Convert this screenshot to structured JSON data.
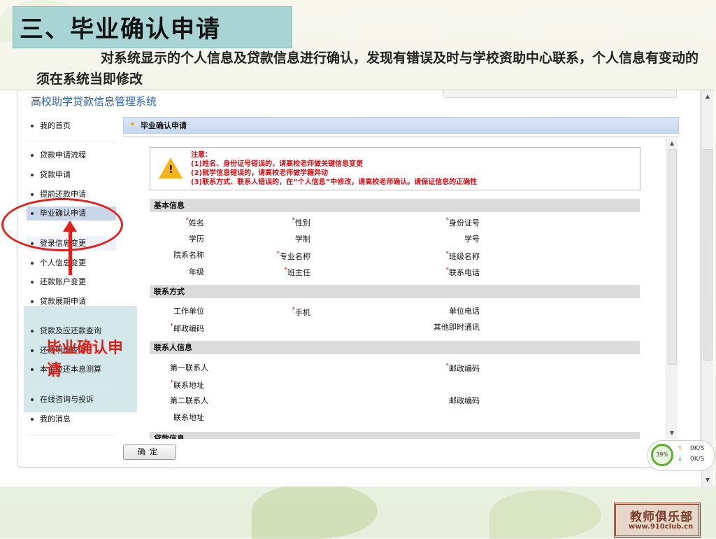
{
  "slide": {
    "title": "三、毕业确认申请",
    "description": "对系统显示的个人信息及贷款信息进行确认，发现有错误及时与学校资助中心联系，个人信息有变动的须在系统当即修改",
    "annotation": "毕业确认申请"
  },
  "system": {
    "title": "高校助学贷款信息管理系统"
  },
  "nav": {
    "items": [
      {
        "label": "我的首页"
      },
      {
        "label": "贷款申请流程"
      },
      {
        "label": "贷款申请"
      },
      {
        "label": "提前还款申请"
      },
      {
        "label": "毕业确认申请"
      },
      {
        "label": "登录信息变更"
      },
      {
        "label": "个人信息变更"
      },
      {
        "label": "还款账户变更"
      },
      {
        "label": "贷款展期申请"
      },
      {
        "label": "贷款及应还款查询"
      },
      {
        "label": "还款明细查询"
      },
      {
        "label": "本金应还本息测算"
      },
      {
        "label": "在线咨询与投诉"
      },
      {
        "label": "我的消息"
      }
    ]
  },
  "content": {
    "header": "毕业确认申请",
    "notice": {
      "title": "注意：",
      "line1": "(1)姓名、身份证号错误的，请高校老师做关键信息变更",
      "line2": "(2)就学信息错误的，请高校老师做学籍异动",
      "line3": "(3)联系方式、联系人错误的，在“个人信息”中修改，请高校老师确认。请保证信息的正确性"
    },
    "sections": {
      "basic": "基本信息",
      "contact": "联系方式",
      "contact_person": "联系人信息",
      "loan": "贷款信息"
    },
    "fields": {
      "name": "姓名",
      "gender": "性别",
      "id_number": "身份证号",
      "education": "学历",
      "school_system": "学制",
      "student_no": "学号",
      "department": "院系名称",
      "major": "专业名称",
      "class_name": "班级名称",
      "grade": "年级",
      "head_teacher": "班主任",
      "phone": "联系电话",
      "work_unit": "工作单位",
      "mobile": "手机",
      "work_phone": "单位电话",
      "postcode": "邮政编码",
      "im": "其他即时通讯",
      "contact1": "第一联系人",
      "contact1_postcode": "邮政编码",
      "contact_address": "联系地址",
      "contact2": "第二联系人",
      "contact2_postcode": "邮政编码",
      "contact2_address": "联系地址"
    },
    "confirm_label": "确定"
  },
  "net_widget": {
    "percent": "39%",
    "up": "0K/S",
    "down": "0K/S"
  },
  "logo": {
    "line1": "教师俱乐部",
    "line2": "www.910club.cn"
  },
  "colors": {
    "accent_red": "#e0201a",
    "system_blue": "#2b62b2",
    "title_bg": "#a9d4d4"
  }
}
